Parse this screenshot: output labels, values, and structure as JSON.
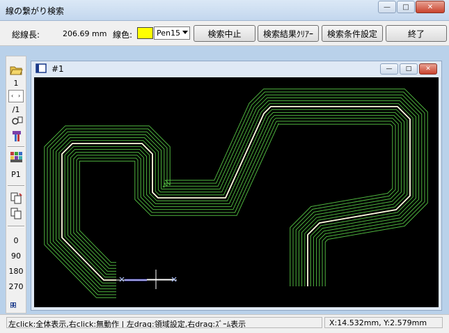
{
  "window": {
    "title": "線の繋がり検索",
    "minimize": "—",
    "maximize": "□",
    "close": "✕"
  },
  "toolbar": {
    "total_length_label": "総線長:",
    "total_length_value": "206.69 mm",
    "line_color_label": "線色:",
    "pen_value": "Pen15",
    "buttons": [
      "検索中止",
      "検索結果ｸﾘｱｰ",
      "検索条件設定",
      "終了"
    ]
  },
  "sidebar": {
    "items": [
      "1",
      "/1",
      "P1",
      "0",
      "90",
      "180",
      "270"
    ],
    "colors": {
      "yellow": "#ffff00",
      "green": "#4fb53f"
    }
  },
  "child_window": {
    "title": "#1"
  },
  "status": {
    "hint": "左click:全体表示,右click:無動作 | 左drag:領域設定,右drag:ｽﾞｰﾑ表示",
    "coords": "X:14.532mm, Y:2.579mm"
  },
  "colors": {
    "trace_green": "#4fb53f",
    "trace_selected": "#fffde0",
    "canvas_bg": "#000000"
  }
}
